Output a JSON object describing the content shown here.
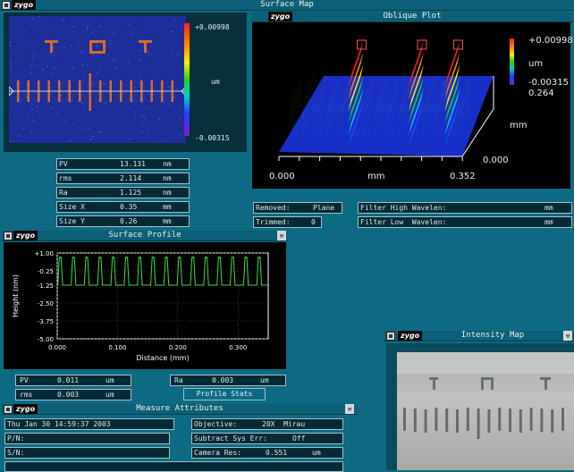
{
  "surface_map": {
    "title": "Surface Map",
    "colorbar_max": "+0.00998",
    "colorbar_unit": "um",
    "colorbar_min": "-0.00315"
  },
  "oblique_plot": {
    "title": "Oblique Plot",
    "colorbar_max": "+0.00998",
    "colorbar_unit": "um",
    "colorbar_min": "-0.00315",
    "y_axis_max": "0.264",
    "y_axis_unit": "mm",
    "y_axis_min": "0.000",
    "x_axis_min": "0.000",
    "x_axis_unit": "mm",
    "x_axis_max": "0.352"
  },
  "stats": [
    {
      "label": "PV",
      "value": "13.131",
      "unit": "nm"
    },
    {
      "label": "rms",
      "value": "2.114",
      "unit": "nm"
    },
    {
      "label": "Ra",
      "value": "1.125",
      "unit": "nm"
    },
    {
      "label": "Size X",
      "value": "0.35",
      "unit": "mm"
    },
    {
      "label": "Size Y",
      "value": "0.26",
      "unit": "mm"
    }
  ],
  "removed": {
    "label": "Removed:",
    "value": "Plane"
  },
  "trimmed": {
    "label": "Trimmed:",
    "value": "0"
  },
  "filter_high": {
    "label": "Filter High Wavelen:",
    "unit": "mm"
  },
  "filter_low": {
    "label": "Filter Low  Wavelen:",
    "unit": "mm"
  },
  "logo": "zygo",
  "surface_profile": {
    "title": "Surface Profile",
    "pv": {
      "label": "PV",
      "value": "0.011",
      "unit": "um"
    },
    "rms": {
      "label": "rms",
      "value": "0.003",
      "unit": "um"
    },
    "ra": {
      "label": "Ra",
      "value": "0.003",
      "unit": "um"
    },
    "profile_stats_button": "Profile Stats"
  },
  "chart_data": {
    "type": "line",
    "title": "",
    "xlabel": "Distance (mm)",
    "ylabel": "Height (nm)",
    "xlim": [
      0.0,
      0.35
    ],
    "ylim": [
      -5.0,
      1.0
    ],
    "x_ticks": [
      "0.000",
      "0.100",
      "0.200",
      "0.300"
    ],
    "y_ticks": [
      "+1.00",
      "-0.25",
      "-1.25",
      "-2.50",
      "-3.75",
      "-5.00"
    ],
    "grid": true,
    "series": [
      {
        "color": "#35e04a",
        "peaks_x": [
          0.005,
          0.027,
          0.049,
          0.071,
          0.093,
          0.115,
          0.137,
          0.159,
          0.181,
          0.203,
          0.225,
          0.247,
          0.269,
          0.291,
          0.313,
          0.335
        ],
        "peak_y": 0.7,
        "base_y": -1.25
      }
    ]
  },
  "measure_attributes": {
    "title": "Measure Attributes",
    "date": "Thu Jan 30 14:59:37 2003",
    "pn_label": "P/N:",
    "sn_label": "S/N:",
    "objective_label": "Objective:",
    "objective_value": "20X  Mirau",
    "subtract_label": "Subtract Sys Err:",
    "subtract_value": "Off",
    "camera_label": "Camera Res:",
    "camera_value": "0.551",
    "camera_unit": "um"
  },
  "intensity_map": {
    "title": "Intensity Map"
  }
}
